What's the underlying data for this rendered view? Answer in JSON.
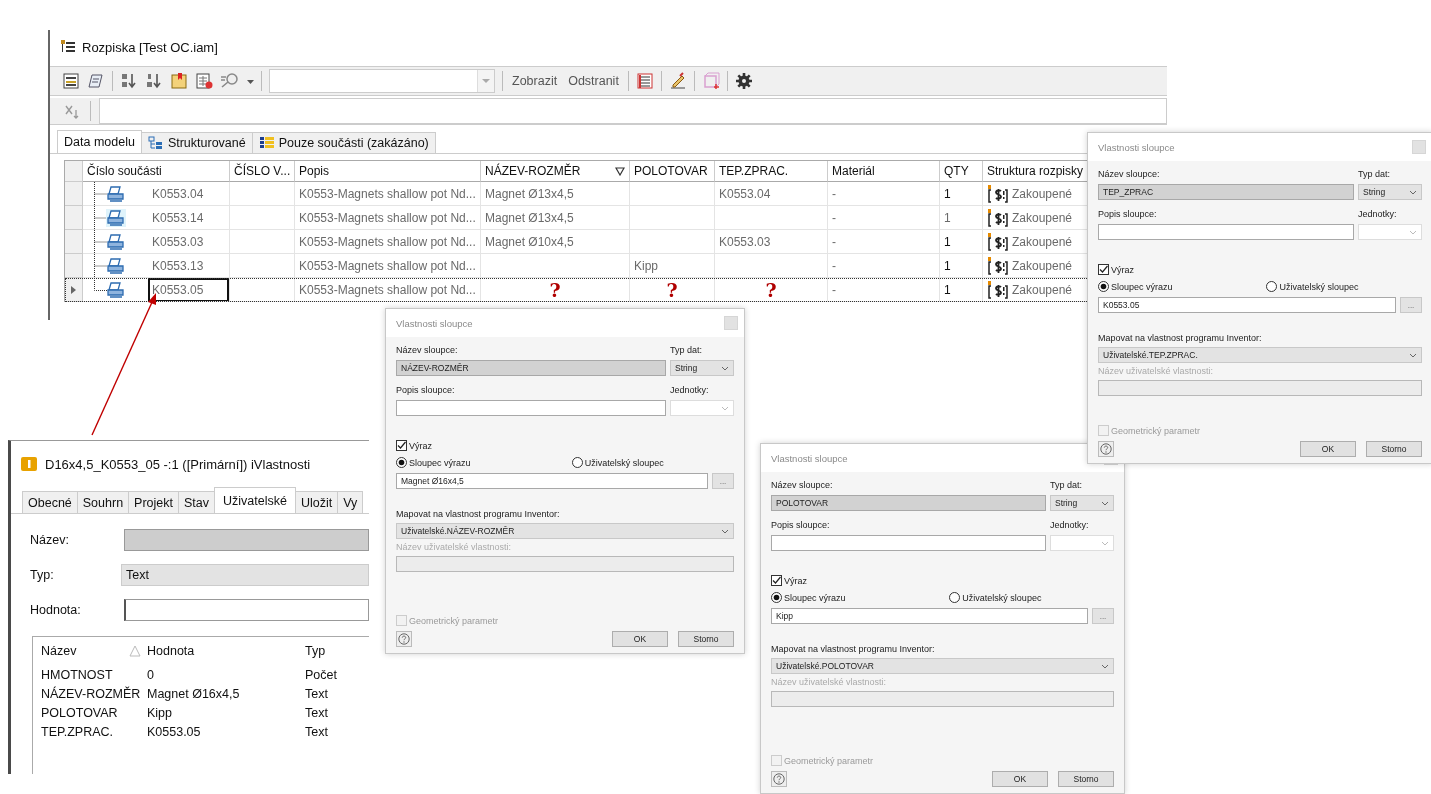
{
  "bom_window": {
    "title": "Rozpiska [Test OC.iam]",
    "toolbar_buttons": [
      "Zobrazit",
      "Odstranit"
    ],
    "tabs": [
      {
        "label": "Data modelu",
        "selected": true,
        "kind": "plain"
      },
      {
        "label": "Strukturované",
        "selected": false,
        "kind": "structured"
      },
      {
        "label": "Pouze součásti (zakázáno)",
        "selected": false,
        "kind": "parts"
      }
    ],
    "columns": [
      {
        "label": "Číslo součásti",
        "filtered": false
      },
      {
        "label": "ČÍSLO V...",
        "filtered": false
      },
      {
        "label": "Popis",
        "filtered": false
      },
      {
        "label": "NÁZEV-ROZMĚR",
        "filtered": true
      },
      {
        "label": "POLOTOVAR",
        "filtered": false
      },
      {
        "label": "TEP.ZPRAC.",
        "filtered": false
      },
      {
        "label": "Materiál",
        "filtered": false
      },
      {
        "label": "QTY",
        "filtered": false
      },
      {
        "label": "Struktura rozpisky",
        "filtered": false
      }
    ],
    "rows": [
      {
        "current": false,
        "highlighted": false,
        "cells": [
          {
            "kind": "part",
            "text": "K0553.04"
          },
          {
            "kind": "empty"
          },
          {
            "kind": "value",
            "text": "K0553-Magnets shallow pot Nd..."
          },
          {
            "kind": "value",
            "text": "Magnet Ø13x4,5"
          },
          {
            "kind": "empty"
          },
          {
            "kind": "value",
            "text": "K0553.04"
          },
          {
            "kind": "value",
            "text": "-"
          },
          {
            "kind": "strong",
            "text": "1"
          },
          {
            "kind": "purchased",
            "text": "Zakoupené"
          }
        ]
      },
      {
        "current": false,
        "highlighted": true,
        "cells": [
          {
            "kind": "part",
            "text": "K0553.14"
          },
          {
            "kind": "empty"
          },
          {
            "kind": "value",
            "text": "K0553-Magnets shallow pot Nd..."
          },
          {
            "kind": "value",
            "text": "Magnet Ø13x4,5"
          },
          {
            "kind": "empty"
          },
          {
            "kind": "empty"
          },
          {
            "kind": "value",
            "text": "-"
          },
          {
            "kind": "value",
            "text": "1"
          },
          {
            "kind": "purchased",
            "text": "Zakoupené"
          }
        ]
      },
      {
        "current": false,
        "highlighted": false,
        "cells": [
          {
            "kind": "part",
            "text": "K0553.03"
          },
          {
            "kind": "empty"
          },
          {
            "kind": "value",
            "text": "K0553-Magnets shallow pot Nd..."
          },
          {
            "kind": "value",
            "text": "Magnet Ø10x4,5"
          },
          {
            "kind": "empty"
          },
          {
            "kind": "value",
            "text": "K0553.03"
          },
          {
            "kind": "value",
            "text": "-"
          },
          {
            "kind": "strong",
            "text": "1"
          },
          {
            "kind": "purchased",
            "text": "Zakoupené"
          }
        ]
      },
      {
        "current": false,
        "highlighted": false,
        "cells": [
          {
            "kind": "part",
            "text": "K0553.13"
          },
          {
            "kind": "empty"
          },
          {
            "kind": "value",
            "text": "K0553-Magnets shallow pot Nd..."
          },
          {
            "kind": "empty"
          },
          {
            "kind": "value",
            "text": "Kipp"
          },
          {
            "kind": "empty"
          },
          {
            "kind": "value",
            "text": "-"
          },
          {
            "kind": "strong",
            "text": "1"
          },
          {
            "kind": "purchased",
            "text": "Zakoupené"
          }
        ]
      },
      {
        "current": true,
        "highlighted": false,
        "cells": [
          {
            "kind": "part",
            "text": "K0553.05"
          },
          {
            "kind": "empty"
          },
          {
            "kind": "value",
            "text": "K0553-Magnets shallow pot Nd..."
          },
          {
            "kind": "query",
            "text": "?"
          },
          {
            "kind": "query",
            "text": "?"
          },
          {
            "kind": "query",
            "text": "?"
          },
          {
            "kind": "value",
            "text": "-"
          },
          {
            "kind": "strong",
            "text": "1"
          },
          {
            "kind": "purchased",
            "text": "Zakoupené"
          }
        ]
      }
    ]
  },
  "column_dialogs": [
    {
      "title": "Vlastnosti sloupce",
      "name_label": "Název sloupce:",
      "name_value": "TEP_ZPRAC",
      "type_label": "Typ dat:",
      "type_value": "String",
      "description_label": "Popis sloupce:",
      "units_label": "Jednotky:",
      "expression": {
        "label": "Výraz",
        "checked": true
      },
      "sources": [
        {
          "label": "Sloupec výrazu",
          "selected": true
        },
        {
          "label": "Uživatelský sloupec",
          "selected": false
        }
      ],
      "expression_value": "K0553.05",
      "browse_button": "...",
      "map_label": "Mapovat na vlastnost programu Inventor:",
      "map_value": "Uživatelské.TEP.ZPRAC.",
      "custom_label": "Název uživatelské vlastnosti:",
      "geometric": {
        "label": "Geometrický parametr",
        "checked": false,
        "disabled": true
      },
      "buttons": [
        "OK",
        "Storno"
      ]
    },
    {
      "title": "Vlastnosti sloupce",
      "name_label": "Název sloupce:",
      "name_value": "NÁZEV-ROZMĚR",
      "type_label": "Typ dat:",
      "type_value": "String",
      "description_label": "Popis sloupce:",
      "units_label": "Jednotky:",
      "expression": {
        "label": "Výraz",
        "checked": true
      },
      "sources": [
        {
          "label": "Sloupec výrazu",
          "selected": true
        },
        {
          "label": "Uživatelský sloupec",
          "selected": false
        }
      ],
      "expression_value": "Magnet Ø16x4,5",
      "browse_button": "...",
      "map_label": "Mapovat na vlastnost programu Inventor:",
      "map_value": "Uživatelské.NÁZEV-ROZMĚR",
      "custom_label": "Název uživatelské vlastnosti:",
      "geometric": {
        "label": "Geometrický parametr",
        "checked": false,
        "disabled": true
      },
      "buttons": [
        "OK",
        "Storno"
      ]
    },
    {
      "title": "Vlastnosti sloupce",
      "name_label": "Název sloupce:",
      "name_value": "POLOTOVAR",
      "type_label": "Typ dat:",
      "type_value": "String",
      "description_label": "Popis sloupce:",
      "units_label": "Jednotky:",
      "expression": {
        "label": "Výraz",
        "checked": true
      },
      "sources": [
        {
          "label": "Sloupec výrazu",
          "selected": true
        },
        {
          "label": "Uživatelský sloupec",
          "selected": false
        }
      ],
      "expression_value": "Kipp",
      "browse_button": "...",
      "map_label": "Mapovat na vlastnost programu Inventor:",
      "map_value": "Uživatelské.POLOTOVAR",
      "custom_label": "Název uživatelské vlastnosti:",
      "geometric": {
        "label": "Geometrický parametr",
        "checked": false,
        "disabled": true
      },
      "buttons": [
        "OK",
        "Storno"
      ]
    }
  ],
  "iproperties": {
    "title": "D16x4,5_K0553_05 -:1 ([Primární]) iVlastnosti",
    "tabs": [
      {
        "label": "Obecné",
        "selected": false
      },
      {
        "label": "Souhrn",
        "selected": false
      },
      {
        "label": "Projekt",
        "selected": false
      },
      {
        "label": "Stav",
        "selected": false
      },
      {
        "label": "Uživatelské",
        "selected": true
      },
      {
        "label": "Uložit",
        "selected": false
      },
      {
        "label": "Vy",
        "selected": false
      }
    ],
    "fields": [
      {
        "label": "Název:",
        "kind": "readonly"
      },
      {
        "label": "Typ:",
        "kind": "combo",
        "value": "Text"
      },
      {
        "label": "Hodnota:",
        "kind": "input"
      }
    ],
    "list": {
      "columns": [
        {
          "label": "Název",
          "sorted": true
        },
        {
          "label": "Hodnota",
          "sorted": false
        },
        {
          "label": "Typ",
          "sorted": false
        }
      ],
      "rows": [
        [
          "HMOTNOST",
          "0",
          "Počet"
        ],
        [
          "NÁZEV-ROZMĚR",
          "Magnet Ø16x4,5",
          "Text"
        ],
        [
          "POLOTOVAR",
          "Kipp",
          "Text"
        ],
        [
          "TEP.ZPRAC.",
          "K0553.05",
          "Text"
        ]
      ]
    }
  }
}
